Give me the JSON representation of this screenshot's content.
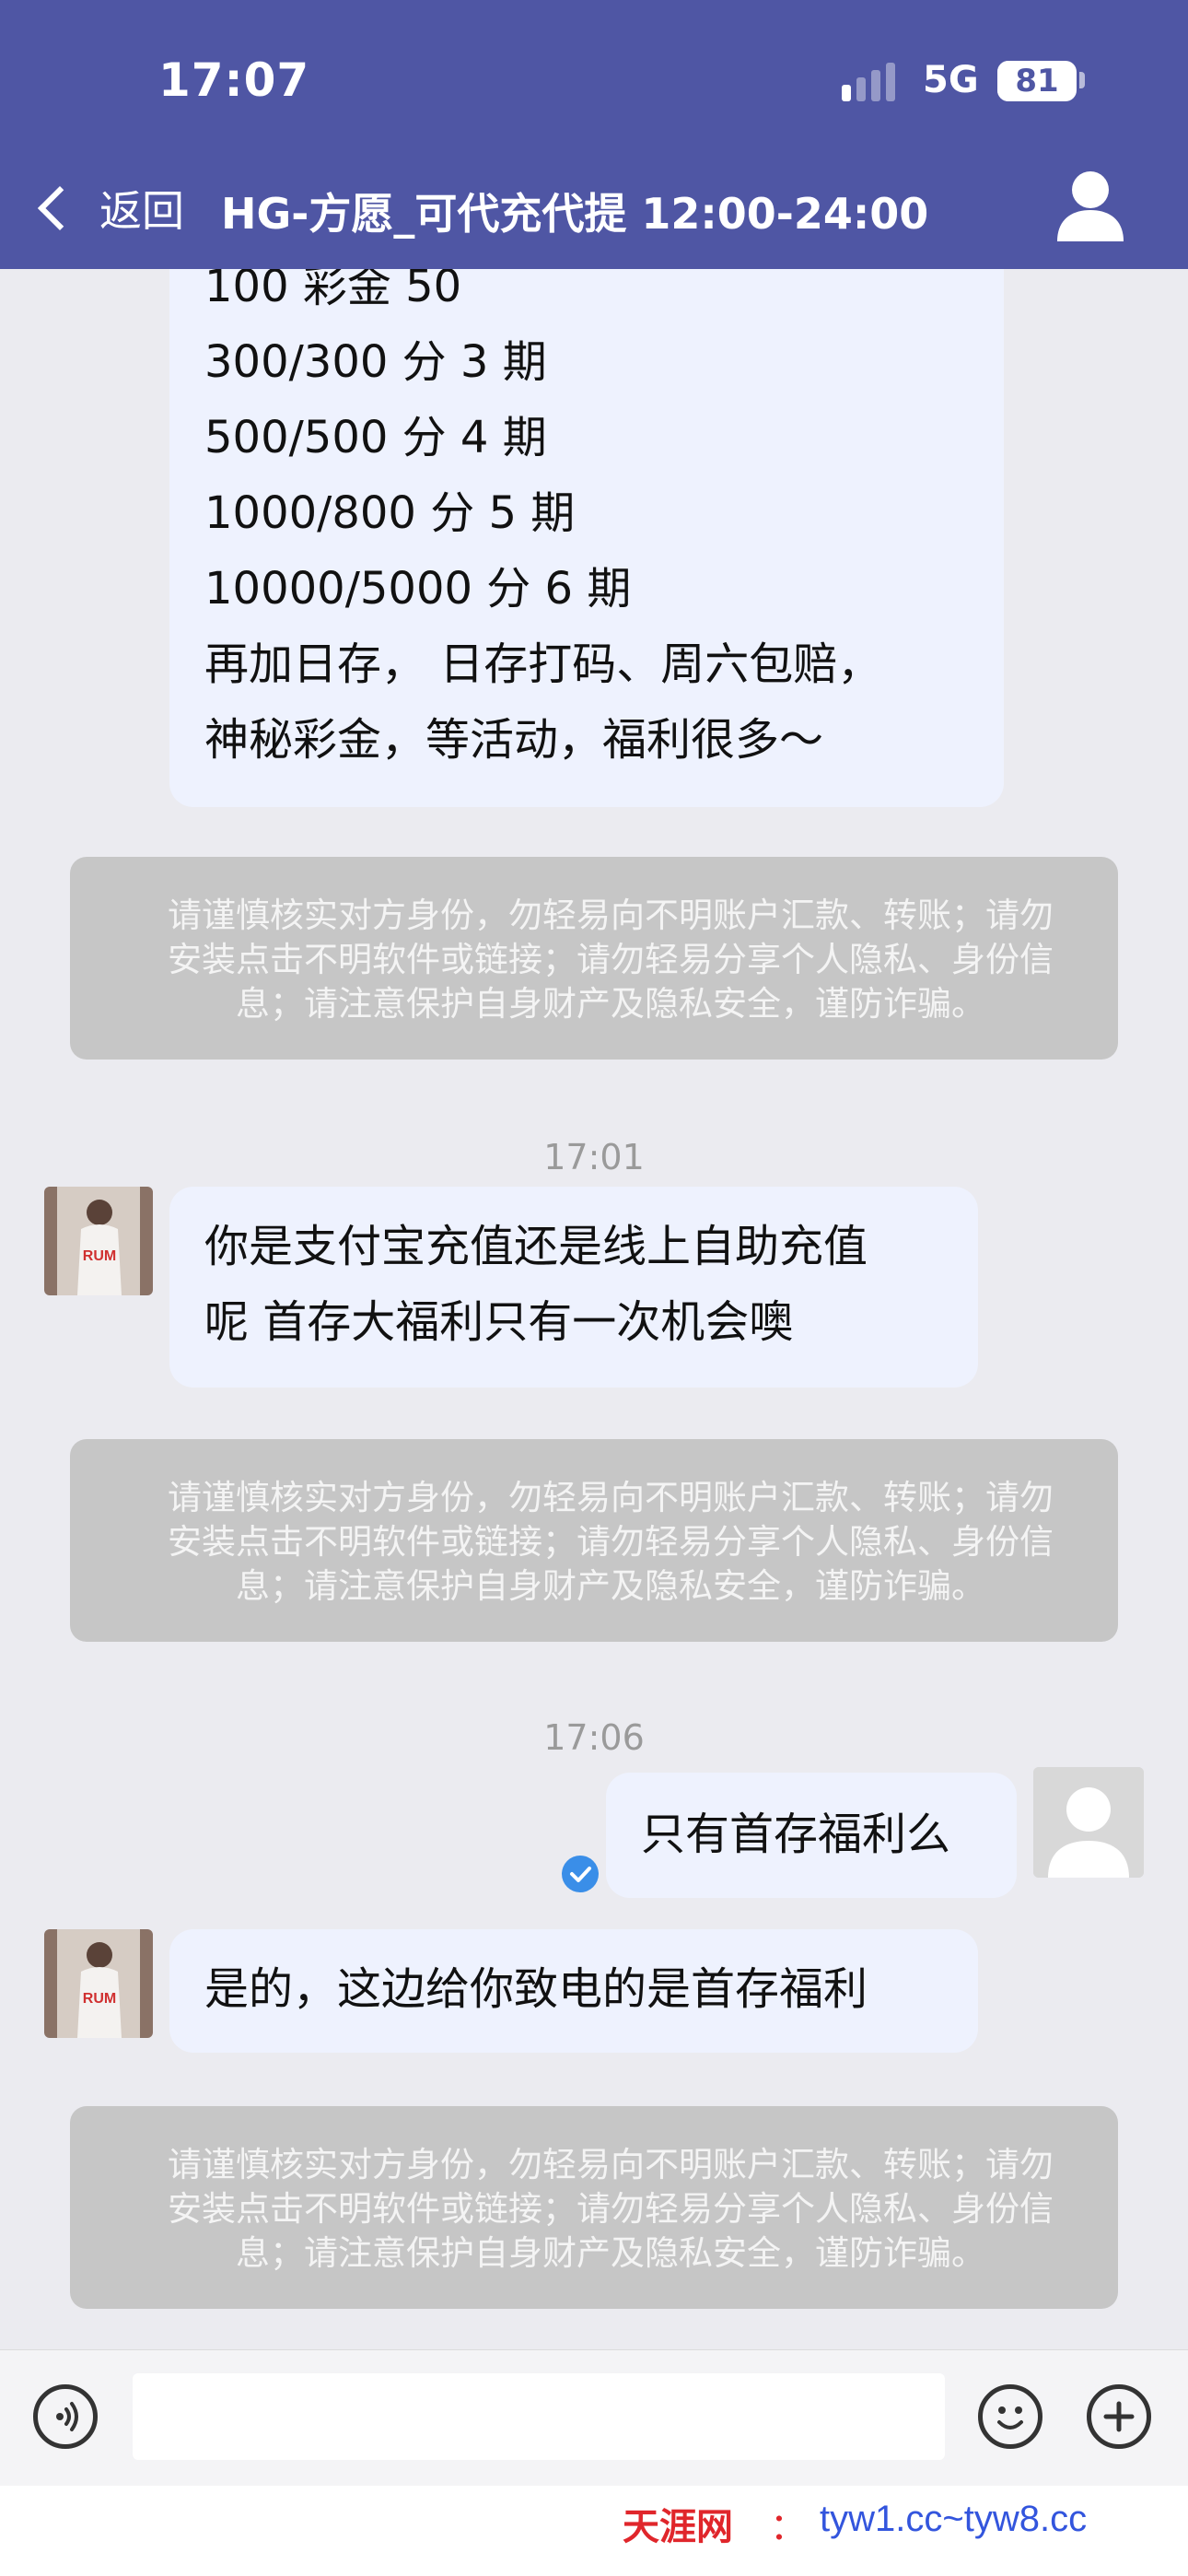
{
  "status_bar": {
    "time": "17:07",
    "network": "5G",
    "battery": "81",
    "battery_level": 0.81
  },
  "header": {
    "back_label": "返回",
    "title": "HG-方愿_可代充代提  12:00-24:00"
  },
  "messages": {
    "promo_lines": [
      "100 彩金 50",
      "300/300 分 3 期",
      "500/500 分 4 期",
      "1000/800 分 5 期",
      "10000/5000 分 6 期",
      "再加日存， 日存打码、周六包赔，",
      "神秘彩金，等活动，福利很多～"
    ],
    "notice_text": "请谨慎核实对方身份，勿轻易向不明账户汇款、转账；请勿\n安装点击不明软件或链接；请勿轻易分享个人隐私、身份信\n息；请注意保护自身财产及隐私安全，谨防诈骗。",
    "time_1": "17:01",
    "msg_1": "你是支付宝充值还是线上自助充值\n呢 首存大福利只有一次机会噢",
    "time_2": "17:06",
    "msg_2": "只有首存福利么",
    "msg_3": "是的，这边给你致电的是首存福利"
  },
  "input": {
    "value": ""
  },
  "footer": {
    "brand": "天涯网",
    "separator": "：",
    "url": "tyw1.cc~tyw8.cc"
  },
  "icons": {
    "back": "chevron-left-icon",
    "user": "person-icon",
    "voice": "voice-icon",
    "emoji": "smiley-icon",
    "plus": "plus-icon",
    "sent": "check-icon"
  },
  "colors": {
    "header": "#4f56a4",
    "bubble": "#eef2fe",
    "notice": "#c6c6c6",
    "check": "#3a8ee8"
  }
}
